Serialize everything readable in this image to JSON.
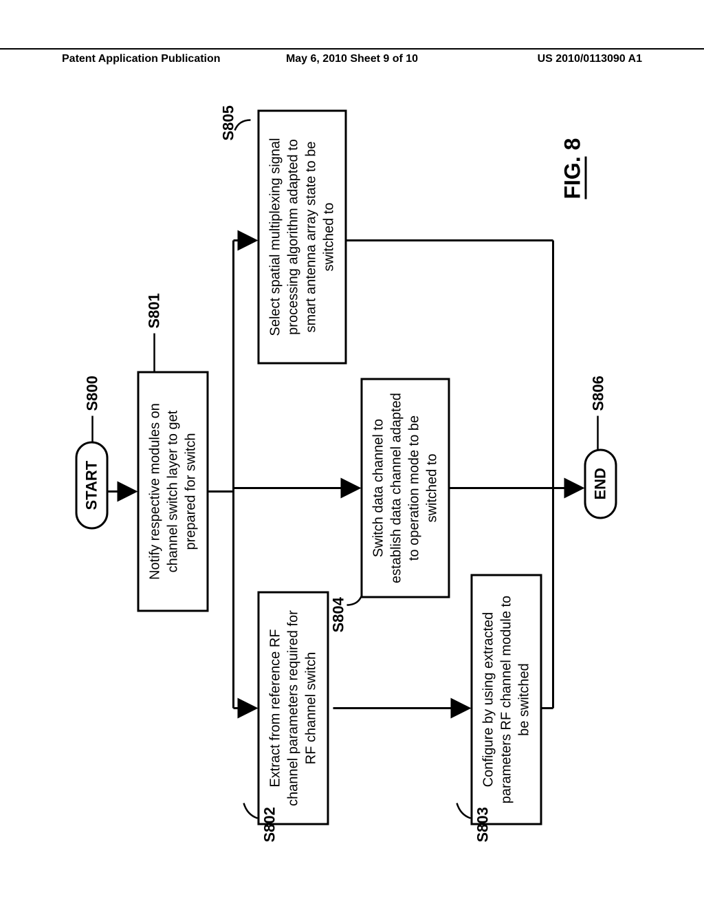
{
  "header": {
    "left": "Patent Application Publication",
    "center": "May 6, 2010  Sheet 9 of 10",
    "right": "US 2010/0113090 A1"
  },
  "flowchart": {
    "start": "START",
    "end": "END",
    "label_start": "S800",
    "label_s801": "S801",
    "label_s802": "S802",
    "label_s803": "S803",
    "label_s804": "S804",
    "label_s805": "S805",
    "label_s806": "S806",
    "box_s801": "Notify respective modules on channel switch layer to get prepared for switch",
    "box_s802": "Extract from reference RF channel parameters required for   RF channel switch",
    "box_s803": "Configure by using extracted parameters RF channel module to be switched",
    "box_s804": "Switch data channel to establish data channel adapted to operation mode to be switched to",
    "box_s805": "Select spatial multiplexing signal processing algorithm adapted to smart antenna array state to be switched to",
    "figure_label": "FIG. 8"
  }
}
